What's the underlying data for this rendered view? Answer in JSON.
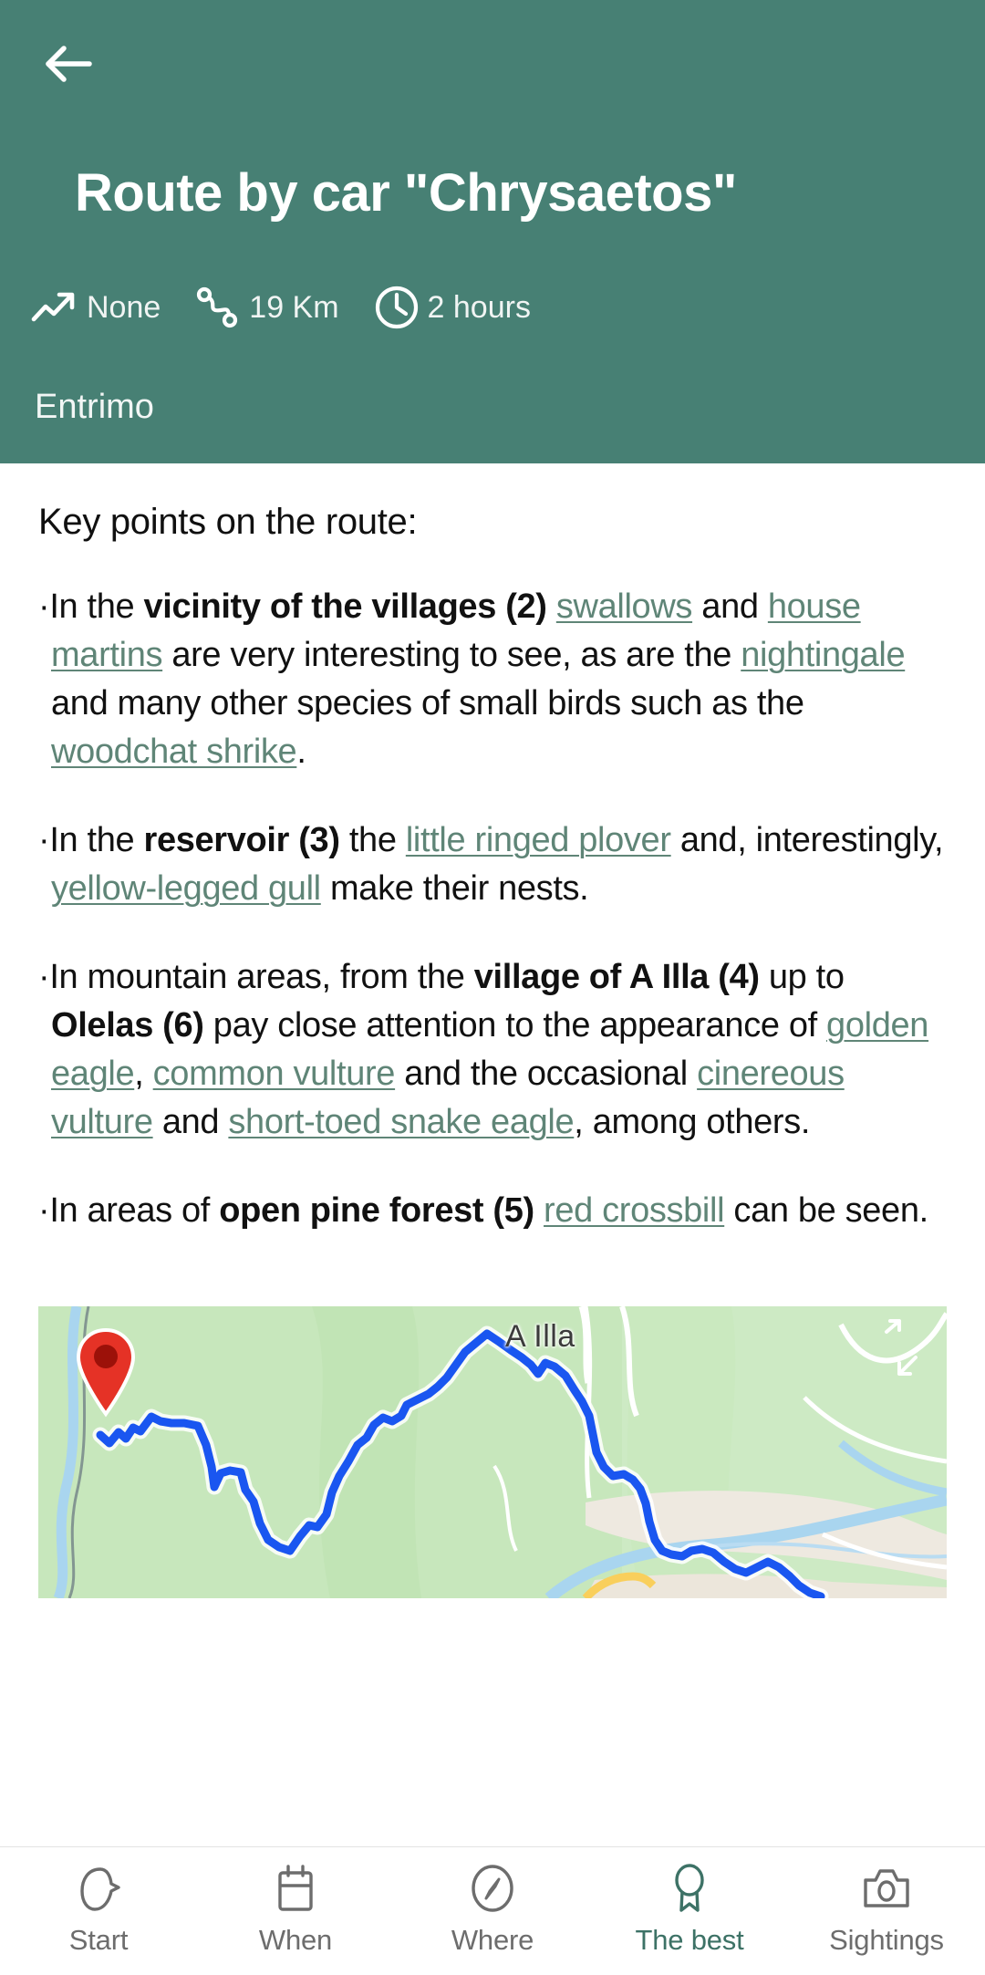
{
  "theme": {
    "header_bg": "#478074",
    "link_color": "#5f8577",
    "active_nav_color": "#3d7266",
    "route_line_color": "#1a56f0",
    "pin_color": "#e53226"
  },
  "header": {
    "back_icon": "arrow-left-icon",
    "title": "Route by car \"Chrysaetos\"",
    "subtitle": "Entrimo",
    "stats": [
      {
        "icon": "trending-up-icon",
        "value": "None"
      },
      {
        "icon": "winding-route-icon",
        "value": "19 Km"
      },
      {
        "icon": "clock-icon",
        "value": "2 hours"
      }
    ]
  },
  "body": {
    "section_title": "Key points on the route:",
    "bullets": [
      {
        "id": "bullet-villages",
        "parts": [
          {
            "t": "bullet",
            "text": "·"
          },
          {
            "t": "plain",
            "text": "In the "
          },
          {
            "t": "bold",
            "text": "vicinity of the villages (2)"
          },
          {
            "t": "plain",
            "text": " "
          },
          {
            "t": "link",
            "text": "swallows"
          },
          {
            "t": "plain",
            "text": " and "
          },
          {
            "t": "link",
            "text": "house martins"
          },
          {
            "t": "plain",
            "text": " are very interesting to see, as are the "
          },
          {
            "t": "link",
            "text": "nightingale"
          },
          {
            "t": "plain",
            "text": " and many other species of small birds such as the "
          },
          {
            "t": "link",
            "text": "woodchat shrike"
          },
          {
            "t": "plain",
            "text": "."
          }
        ]
      },
      {
        "id": "bullet-reservoir",
        "parts": [
          {
            "t": "bullet",
            "text": "·"
          },
          {
            "t": "plain",
            "text": "In the "
          },
          {
            "t": "bold",
            "text": "reservoir (3)"
          },
          {
            "t": "plain",
            "text": " the "
          },
          {
            "t": "link",
            "text": "little ringed plover"
          },
          {
            "t": "plain",
            "text": " and, interestingly, "
          },
          {
            "t": "link",
            "text": "yellow-legged gull"
          },
          {
            "t": "plain",
            "text": " make their nests."
          }
        ]
      },
      {
        "id": "bullet-mountain",
        "parts": [
          {
            "t": "bullet",
            "text": "·"
          },
          {
            "t": "plain",
            "text": "In mountain areas, from the "
          },
          {
            "t": "bold",
            "text": "village of A Illa (4)"
          },
          {
            "t": "plain",
            "text": " up to "
          },
          {
            "t": "bold",
            "text": "Olelas (6)"
          },
          {
            "t": "plain",
            "text": " pay close attention to the appearance of "
          },
          {
            "t": "link",
            "text": "golden eagle"
          },
          {
            "t": "plain",
            "text": ", "
          },
          {
            "t": "link",
            "text": "common vulture"
          },
          {
            "t": "plain",
            "text": " and the occasional "
          },
          {
            "t": "link",
            "text": "cinereous vulture"
          },
          {
            "t": "plain",
            "text": " and "
          },
          {
            "t": "link",
            "text": "short-toed snake eagle"
          },
          {
            "t": "plain",
            "text": ", among others."
          }
        ]
      },
      {
        "id": "bullet-pine-forest",
        "parts": [
          {
            "t": "bullet",
            "text": "·"
          },
          {
            "t": "plain",
            "text": "In areas of "
          },
          {
            "t": "bold",
            "text": "open pine forest (5)"
          },
          {
            "t": "plain",
            "text": " "
          },
          {
            "t": "link",
            "text": "red crossbill"
          },
          {
            "t": "plain",
            "text": " can be seen."
          }
        ]
      }
    ]
  },
  "map": {
    "label": "A Illa",
    "marker_icon": "map-pin-icon"
  },
  "bottom_nav": {
    "items": [
      {
        "id": "start",
        "icon": "bird-icon",
        "label": "Start",
        "active": false
      },
      {
        "id": "when",
        "icon": "calendar-icon",
        "label": "When",
        "active": false
      },
      {
        "id": "where",
        "icon": "compass-icon",
        "label": "Where",
        "active": false
      },
      {
        "id": "the-best",
        "icon": "award-icon",
        "label": "The best",
        "active": true
      },
      {
        "id": "sightings",
        "icon": "camera-icon",
        "label": "Sightings",
        "active": false
      }
    ]
  }
}
